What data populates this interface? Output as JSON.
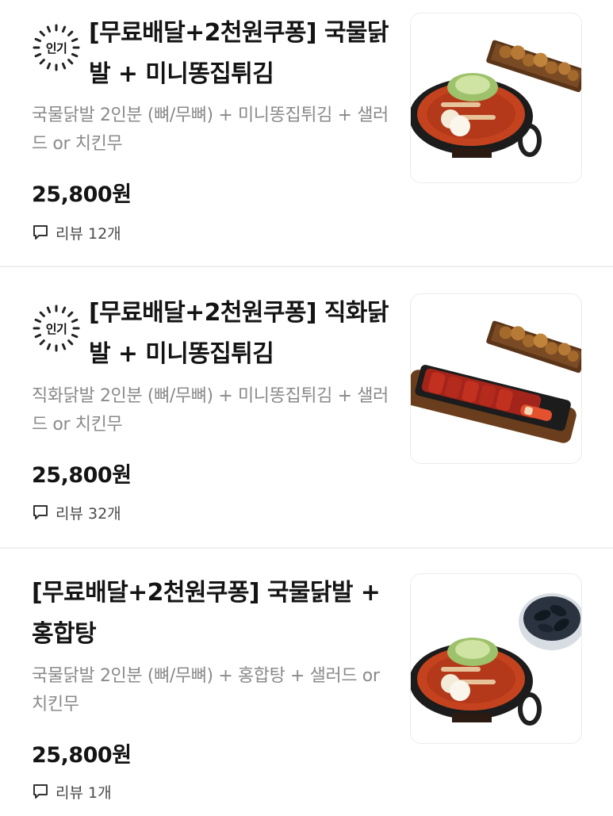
{
  "items": [
    {
      "badge": "인기",
      "title": "[무료배달+2천원쿠퐁] 국물닭발 + 미니똥집튀김",
      "description": "국물닭발 2인분 (뼈/무뼈) + 미니똥집튀김 + 샐러드 or 치킨무",
      "price": "25,800원",
      "review_label": "리뷰 12개",
      "thumb_icon": "soup-chicken-feet-with-fried-gizzard-photo"
    },
    {
      "badge": "인기",
      "title": "[무료배달+2천원쿠퐁] 직화닭발 + 미니똥집튀김",
      "description": "직화닭발 2인분 (뼈/무뼈) + 미니똥집튀김 + 샐러드 or 치킨무",
      "price": "25,800원",
      "review_label": "리뷰 32개",
      "thumb_icon": "grilled-chicken-feet-with-fried-gizzard-photo"
    },
    {
      "badge": "",
      "title": "[무료배달+2천원쿠퐁] 국물닭발 + 홍합탕",
      "description": "국물닭발 2인분 (뼈/무뼈) + 홍합탕 + 샐러드 or 치킨무",
      "price": "25,800원",
      "review_label": "리뷰 1개",
      "thumb_icon": "soup-chicken-feet-with-mussel-soup-photo"
    }
  ],
  "icons": {
    "badge": "sunburst-badge-icon",
    "review": "speech-bubble-icon"
  },
  "colors": {
    "title": "#141414",
    "description": "#8a8a8a",
    "divider": "#efefef"
  }
}
